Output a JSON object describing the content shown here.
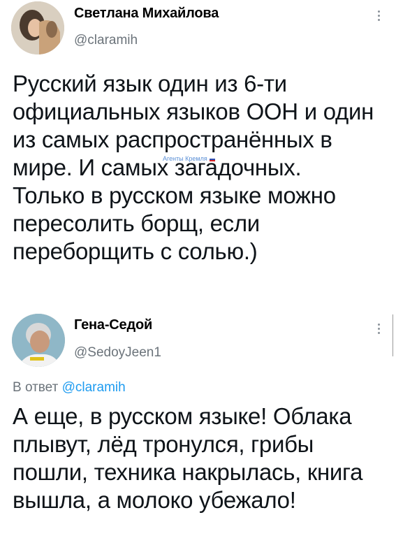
{
  "tweets": [
    {
      "name": "Светлана Михайлова",
      "handle": "@claramih",
      "body": "Русский язык один из 6-ти официальных языков ООН и один из самых распространённых в мире. И самых загадочных. Только в русском языке можно пересолить борщ, если переборщить с солью.)",
      "watermark": "Агенты Кремля"
    },
    {
      "name": "Гена-Седой",
      "handle": "@SedoyJeen1",
      "reply_prefix": "В ответ",
      "reply_handle": "@claramih",
      "body": "А еще, в русском языке! Облака плывут, лёд тронулся, грибы пошли, техника накрылась, книга вышла, а молоко убежало!"
    }
  ],
  "colors": {
    "text": "#0f1419",
    "secondary": "#6b737a",
    "link": "#1d9bf0"
  }
}
